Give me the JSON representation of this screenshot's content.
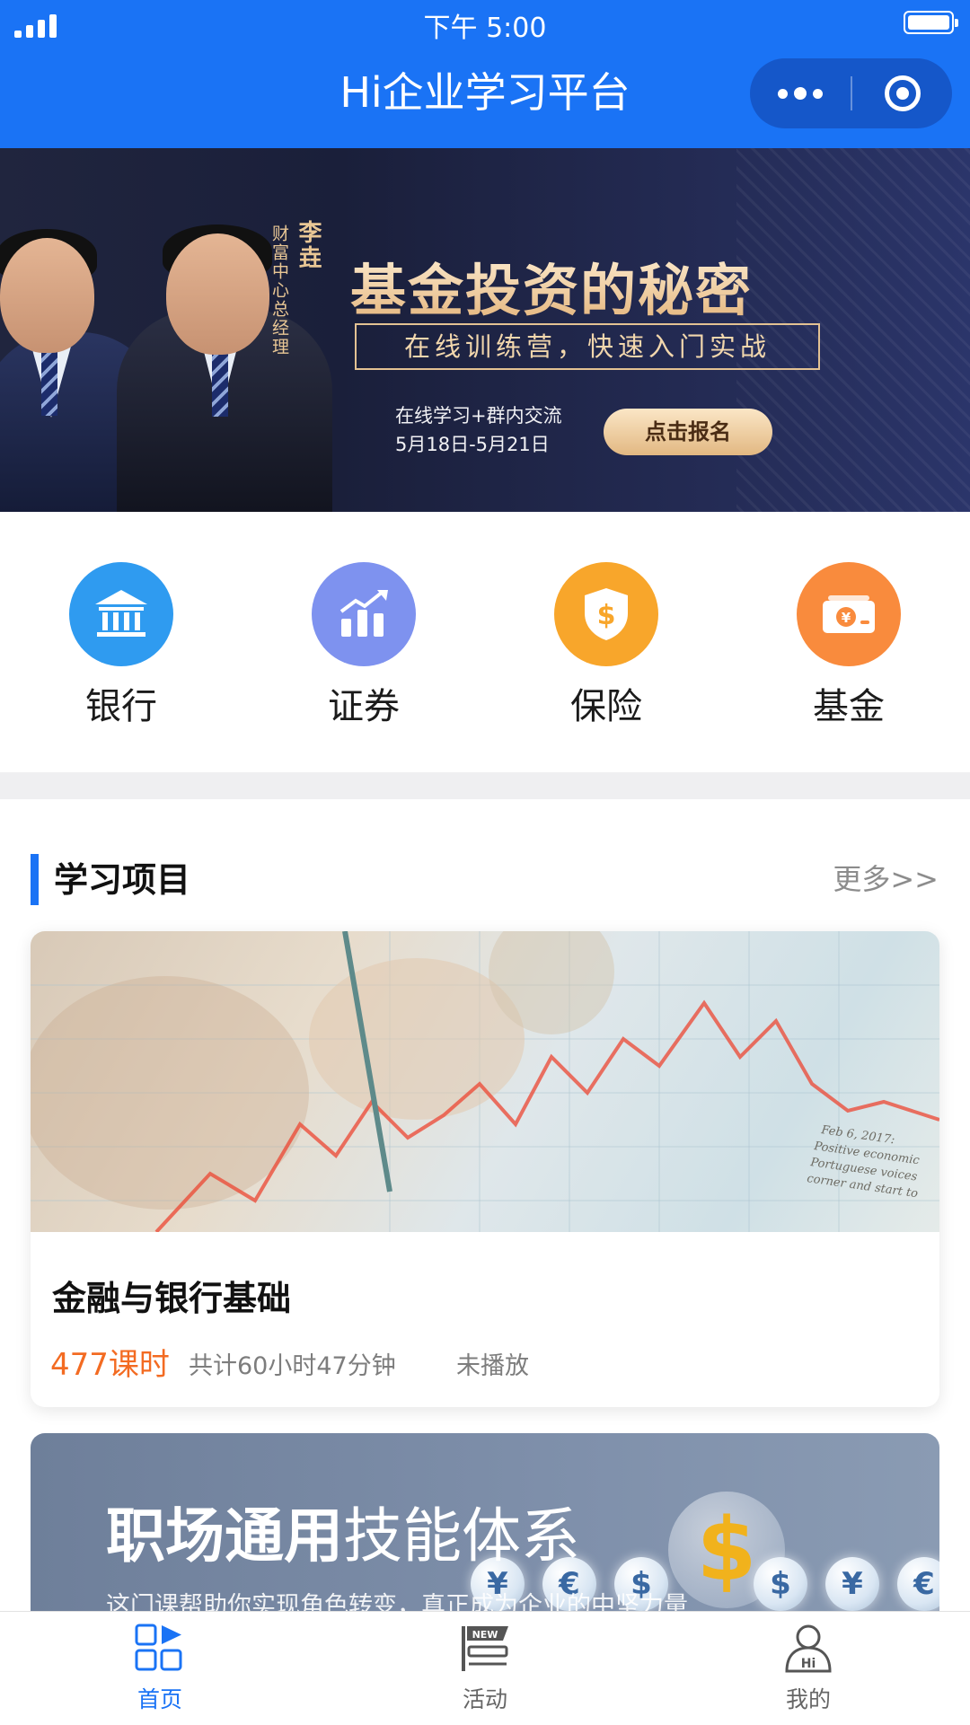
{
  "status_bar": {
    "time": "下午 5:00"
  },
  "header": {
    "title": "Hi企业学习平台"
  },
  "banner": {
    "title": "基金投资的秘密",
    "subtitle": "在线训练营，快速入门实战",
    "lecturer_name": "李垚",
    "lecturer_title": "财富中心总经理",
    "info_line1": "在线学习+群内交流",
    "info_line2": "5月18日-5月21日",
    "cta_label": "点击报名"
  },
  "categories": [
    {
      "label": "银行",
      "icon": "bank-icon",
      "color": "#2f9bf0"
    },
    {
      "label": "证券",
      "icon": "chart-up-icon",
      "color": "#7e92ef"
    },
    {
      "label": "保险",
      "icon": "shield-dollar-icon",
      "color": "#f8a62b"
    },
    {
      "label": "基金",
      "icon": "cash-icon",
      "color": "#f98b3d"
    }
  ],
  "section": {
    "title": "学习项目",
    "more": "更多>>"
  },
  "course": {
    "name": "金融与银行基础",
    "hours": "477课时",
    "total": "共计60小时47分钟",
    "status": "未播放",
    "image_caption": "Feb 6, 2017: Positive economic Portuguese voices corner and start to"
  },
  "course2": {
    "title_bold": "职场通用",
    "title_rest": "技能体系",
    "description": "这门课帮助你实现角色转变，真正成为企业的中坚力量",
    "coins": [
      "¥",
      "€",
      "$",
      "$",
      "$",
      "¥",
      "€"
    ]
  },
  "tabbar": {
    "items": [
      {
        "label": "首页",
        "icon": "home-grid-icon"
      },
      {
        "label": "活动",
        "icon": "new-activity-icon",
        "badge": "NEW"
      },
      {
        "label": "我的",
        "icon": "profile-hi-icon",
        "badge": "Hi"
      }
    ]
  },
  "colors": {
    "brand": "#1a73f5",
    "accent_orange": "#f36b22"
  }
}
